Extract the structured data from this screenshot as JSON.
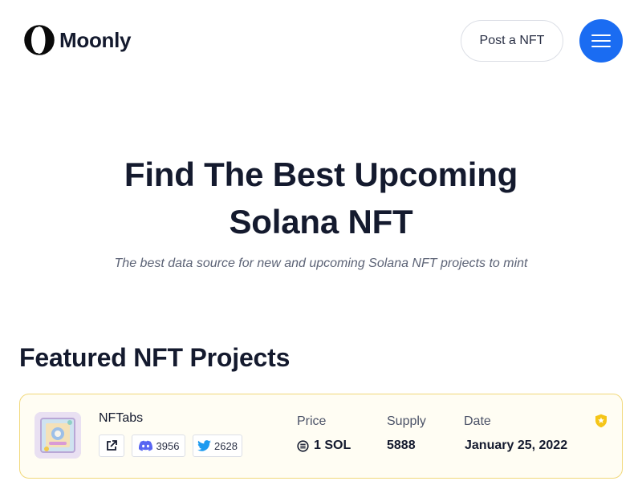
{
  "header": {
    "brand": "Moonly",
    "post_label": "Post a NFT"
  },
  "hero": {
    "title_line1": "Find The Best Upcoming",
    "title_line2": "Solana NFT",
    "subtitle": "The best data source for new and upcoming Solana NFT projects to mint"
  },
  "featured": {
    "title": "Featured NFT Projects",
    "project": {
      "name": "NFTabs",
      "discord_count": "3956",
      "twitter_count": "2628",
      "price_label": "Price",
      "price_value": "1 SOL",
      "supply_label": "Supply",
      "supply_value": "5888",
      "date_label": "Date",
      "date_value": "January 25, 2022"
    }
  },
  "colors": {
    "accent": "#1a6cf2",
    "card_border": "#f1d879",
    "badge": "#f5c518",
    "discord": "#5865f2",
    "twitter": "#1d9bf0"
  },
  "icons": [
    "moon-logo-icon",
    "hamburger-icon",
    "external-link-icon",
    "discord-icon",
    "twitter-icon",
    "solana-icon",
    "verified-badge-icon"
  ]
}
